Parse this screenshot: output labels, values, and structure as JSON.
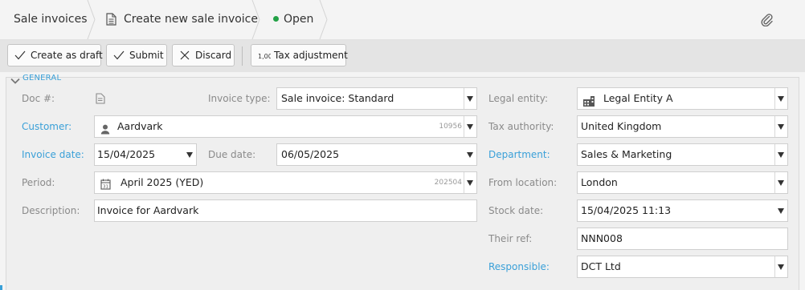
{
  "breadcrumb": {
    "root": "Sale invoices",
    "current": "Create new sale invoice",
    "status": "Open"
  },
  "toolbar": {
    "draft_label": "Create as draft",
    "submit_label": "Submit",
    "discard_label": "Discard",
    "tax_label": "Tax adjustment"
  },
  "section": {
    "title": "GENERAL"
  },
  "form": {
    "doc_label": "Doc #:",
    "invoice_type_label": "Invoice type:",
    "invoice_type_value": "Sale invoice: Standard",
    "customer_label": "Customer:",
    "customer_value": "Aardvark",
    "customer_code": "10956",
    "invoice_date_label": "Invoice date:",
    "invoice_date_value": "15/04/2025",
    "due_date_label": "Due date:",
    "due_date_value": "06/05/2025",
    "period_label": "Period:",
    "period_value": "April 2025 (YED)",
    "period_code": "202504",
    "description_label": "Description:",
    "description_value": "Invoice for Aardvark",
    "legal_entity_label": "Legal entity:",
    "legal_entity_value": "Legal Entity A",
    "tax_authority_label": "Tax authority:",
    "tax_authority_value": "United Kingdom",
    "department_label": "Department:",
    "department_value": "Sales & Marketing",
    "from_location_label": "From location:",
    "from_location_value": "London",
    "stock_date_label": "Stock date:",
    "stock_date_value": "15/04/2025 11:13",
    "their_ref_label": "Their ref:",
    "their_ref_value": "NNN008",
    "responsible_label": "Responsible:",
    "responsible_value": "DCT Ltd"
  },
  "icons": {
    "doc": "document-icon",
    "customer": "person-icon",
    "period": "calendar-icon",
    "legal_entity": "building-icon",
    "attach": "paperclip-icon"
  },
  "colors": {
    "link": "#3aa0d8",
    "status": "#22a146"
  }
}
